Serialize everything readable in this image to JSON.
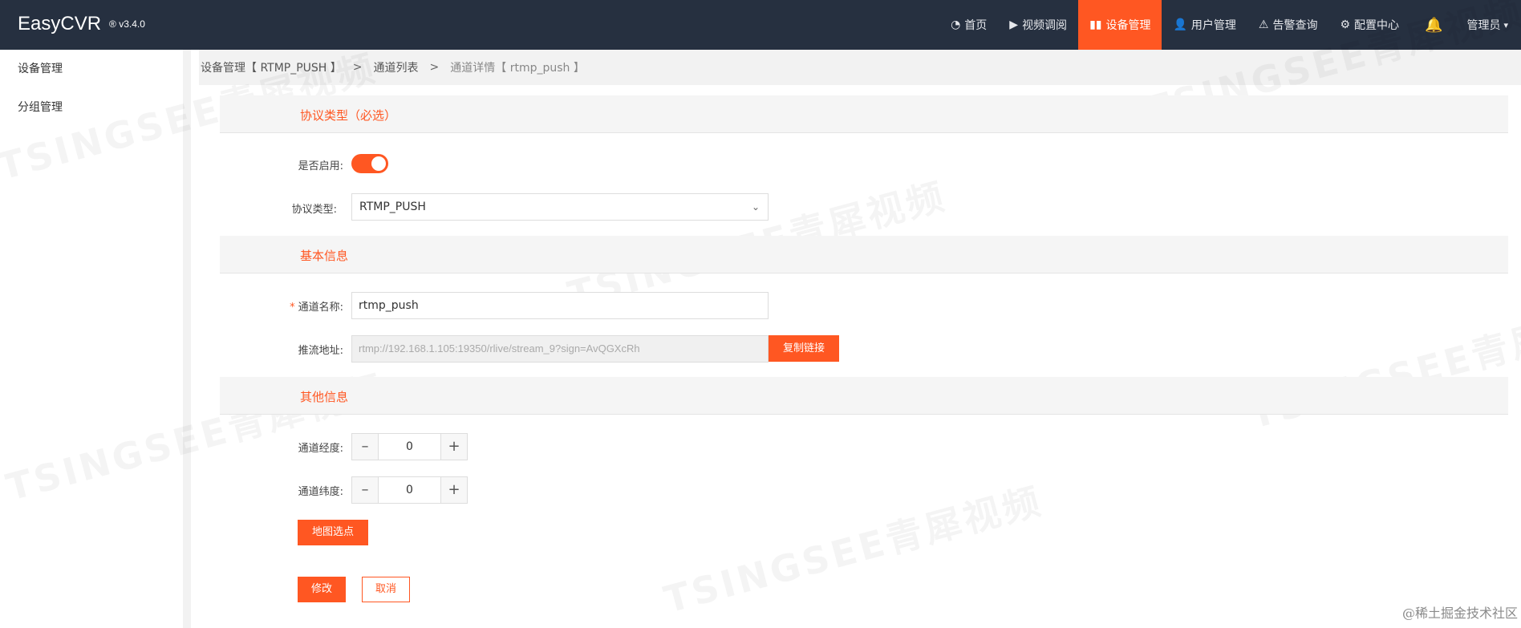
{
  "header": {
    "brand": "EasyCVR",
    "version": "® v3.4.0",
    "nav": [
      {
        "label": "首页",
        "icon": "dashboard-icon"
      },
      {
        "label": "视频调阅",
        "icon": "play-circle-icon"
      },
      {
        "label": "设备管理",
        "icon": "book-icon",
        "active": true
      },
      {
        "label": "用户管理",
        "icon": "user-icon"
      },
      {
        "label": "告警查询",
        "icon": "alarm-icon"
      },
      {
        "label": "配置中心",
        "icon": "gear-icon"
      }
    ],
    "user": "管理员"
  },
  "sidebar": {
    "items": [
      {
        "label": "设备管理"
      },
      {
        "label": "分组管理"
      }
    ]
  },
  "breadcrumb": {
    "part1": "设备管理【 RTMP_PUSH 】",
    "sep": ">",
    "part2": "通道列表",
    "part3": "通道详情【 rtmp_push 】"
  },
  "sections": {
    "protocol": "协议类型（必选）",
    "basic": "基本信息",
    "other": "其他信息"
  },
  "form": {
    "enabled_label": "是否启用:",
    "enabled": true,
    "protocol_label": "协议类型:",
    "protocol_value": "RTMP_PUSH",
    "name_label": "通道名称:",
    "name_required": "*",
    "name_value": "rtmp_push",
    "push_label": "推流地址:",
    "push_value": "rtmp://192.168.1.105:19350/rlive/stream_9?sign=AvQGXcRh",
    "copy_button": "复制链接",
    "longitude_label": "通道经度:",
    "longitude_value": "0",
    "latitude_label": "通道纬度:",
    "latitude_value": "0",
    "stepper_minus": "–",
    "stepper_plus": "+",
    "map_button": "地图选点",
    "submit_button": "修改",
    "cancel_button": "取消"
  },
  "watermark_text": "TSINGSEE青犀视频",
  "credit": "@稀土掘金技术社区",
  "colors": {
    "accent": "#ff5722",
    "topbar": "#263040"
  }
}
